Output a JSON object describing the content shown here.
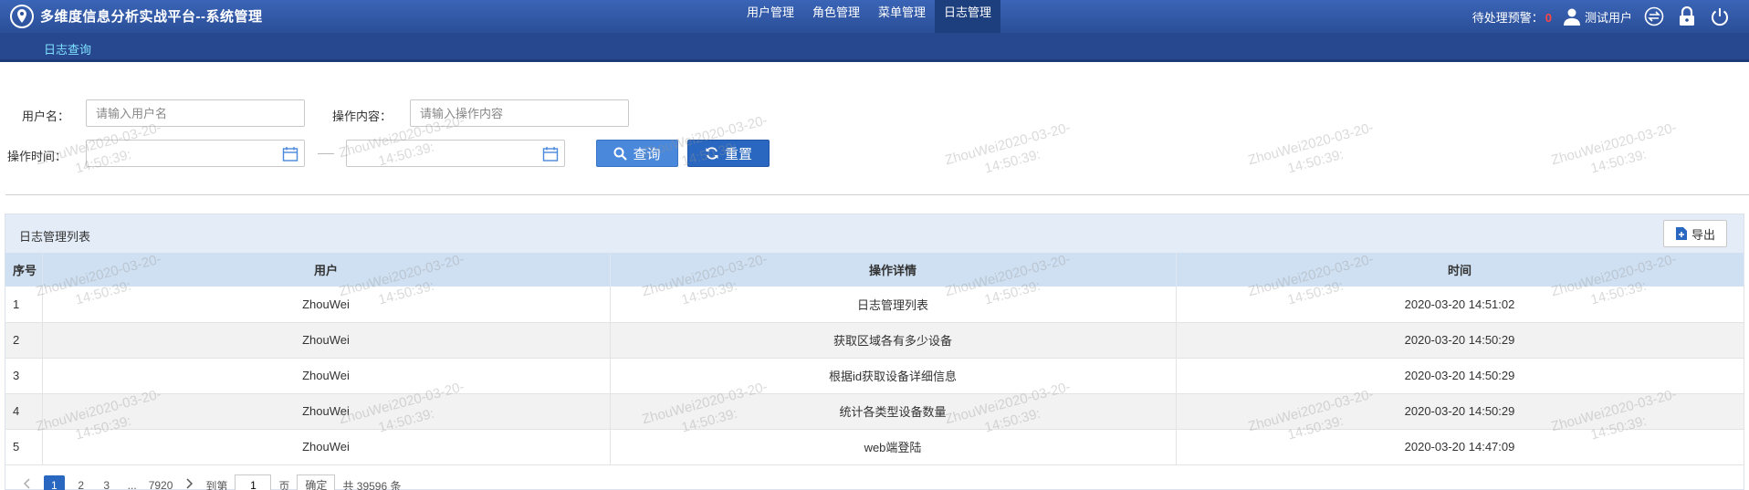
{
  "header": {
    "title": "多维度信息分析实战平台--系统管理",
    "nav": [
      {
        "label": "用户管理",
        "active": false
      },
      {
        "label": "角色管理",
        "active": false
      },
      {
        "label": "菜单管理",
        "active": false
      },
      {
        "label": "日志管理",
        "active": true
      }
    ],
    "alert_label": "待处理预警：",
    "alert_count": "0",
    "user_name": "测试用户",
    "icons": [
      "switch-icon",
      "lock-icon",
      "power-icon"
    ]
  },
  "subnav": {
    "tab": "日志查询"
  },
  "filters": {
    "username_label": "用户名：",
    "username_placeholder": "请输入用户名",
    "content_label": "操作内容：",
    "content_placeholder": "请输入操作内容",
    "time_label": "操作时间：",
    "query_label": "查询",
    "reset_label": "重置"
  },
  "table": {
    "title": "日志管理列表",
    "export_label": "导出",
    "columns": [
      "序号",
      "用户",
      "操作详情",
      "时间"
    ],
    "rows": [
      {
        "idx": "1",
        "user": "ZhouWei",
        "detail": "日志管理列表",
        "time": "2020-03-20 14:51:02"
      },
      {
        "idx": "2",
        "user": "ZhouWei",
        "detail": "获取区域各有多少设备",
        "time": "2020-03-20 14:50:29"
      },
      {
        "idx": "3",
        "user": "ZhouWei",
        "detail": "根据id获取设备详细信息",
        "time": "2020-03-20 14:50:29"
      },
      {
        "idx": "4",
        "user": "ZhouWei",
        "detail": "统计各类型设备数量",
        "time": "2020-03-20 14:50:29"
      },
      {
        "idx": "5",
        "user": "ZhouWei",
        "detail": "web端登陆",
        "time": "2020-03-20 14:47:09"
      }
    ]
  },
  "pagination": {
    "pages": [
      "1",
      "2",
      "3",
      "...",
      "7920"
    ],
    "current": "1",
    "goto_label": "到第",
    "goto_value": "1",
    "page_unit": "页",
    "confirm_label": "确定",
    "total": "共 39596 条"
  },
  "watermark": {
    "line1": "ZhouWei2020-03-20-",
    "line2": "14:50:39:"
  },
  "colors": {
    "header": "#2b4f98",
    "accent": "#2a67c0",
    "subtab": "#7fe0ff"
  }
}
